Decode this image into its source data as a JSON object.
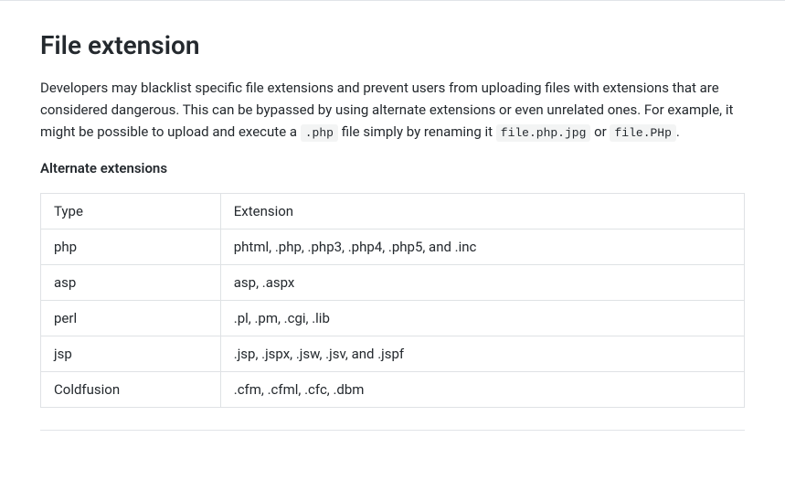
{
  "heading": "File extension",
  "description": {
    "part1": "Developers may blacklist specific file extensions and prevent users from uploading files with extensions that are considered dangerous. This can be bypassed by using alternate extensions or even unrelated ones. For example, it might be possible to upload and execute a ",
    "code1": ".php",
    "part2": " file simply by renaming it ",
    "code2": "file.php.jpg",
    "part3": " or ",
    "code3": "file.PHp",
    "part4": "."
  },
  "subheading": "Alternate extensions",
  "table": {
    "headers": {
      "col1": "Type",
      "col2": "Extension"
    },
    "rows": [
      {
        "type": "php",
        "extension": "phtml, .php, .php3, .php4, .php5, and .inc"
      },
      {
        "type": "asp",
        "extension": "asp, .aspx"
      },
      {
        "type": "perl",
        "extension": ".pl, .pm, .cgi, .lib"
      },
      {
        "type": "jsp",
        "extension": ".jsp, .jspx, .jsw, .jsv, and .jspf"
      },
      {
        "type": "Coldfusion",
        "extension": ".cfm, .cfml, .cfc, .dbm"
      }
    ]
  }
}
